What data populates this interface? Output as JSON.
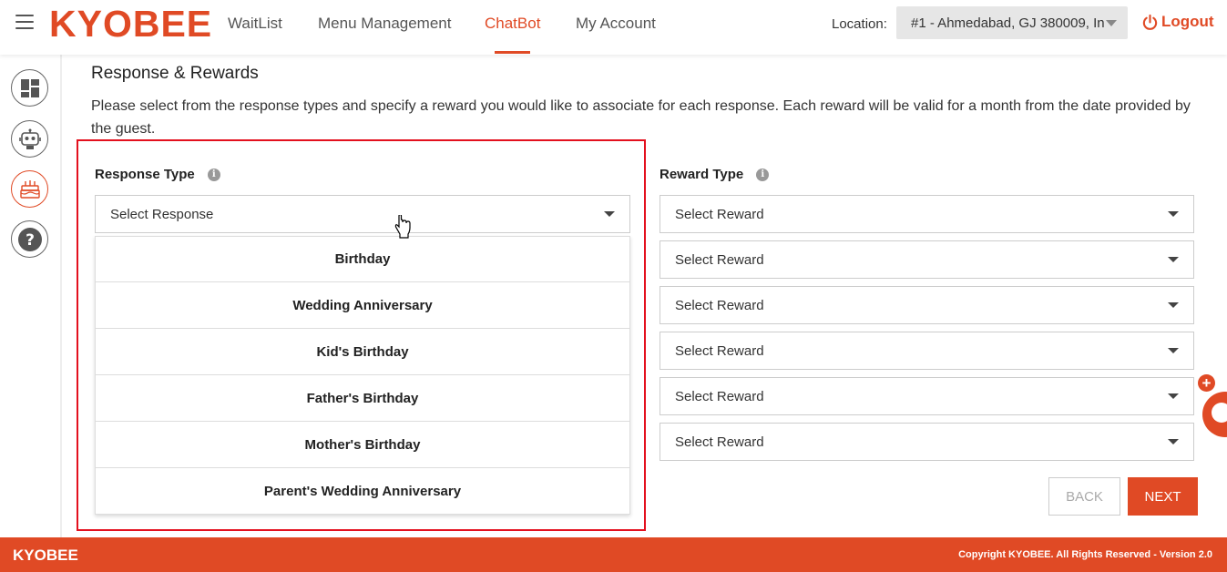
{
  "header": {
    "logo": "KYOBEE",
    "nav": [
      {
        "label": "WaitList"
      },
      {
        "label": "Menu Management"
      },
      {
        "label": "ChatBot"
      },
      {
        "label": "My Account"
      }
    ],
    "location_label": "Location:",
    "location_value": "#1 - Ahmedabad, GJ 380009, In",
    "logout_label": "Logout"
  },
  "sidebar": {
    "items": [
      {
        "icon": "dashboard-icon"
      },
      {
        "icon": "robot-icon"
      },
      {
        "icon": "cake-icon"
      },
      {
        "icon": "help-icon"
      }
    ]
  },
  "main": {
    "title": "Response & Rewards",
    "description": "Please select from the response types and specify a reward you would like to associate for each response. Each reward will be valid for a month from the date provided by the guest.",
    "response_type_label": "Response Type",
    "response_select_value": "Select Response",
    "response_options": [
      "Birthday",
      "Wedding Anniversary",
      "Kid's Birthday",
      "Father's Birthday",
      "Mother's Birthday",
      "Parent's Wedding Anniversary"
    ],
    "reward_type_label": "Reward Type",
    "reward_selects": [
      "Select Reward",
      "Select Reward",
      "Select Reward",
      "Select Reward",
      "Select Reward",
      "Select Reward"
    ],
    "back_label": "BACK",
    "next_label": "NEXT"
  },
  "footer": {
    "logo": "KYOBEE",
    "copyright": "Copyright KYOBEE. All Rights Reserved - Version 2.0"
  },
  "colors": {
    "accent": "#e04a25",
    "highlight": "#e3101e"
  }
}
